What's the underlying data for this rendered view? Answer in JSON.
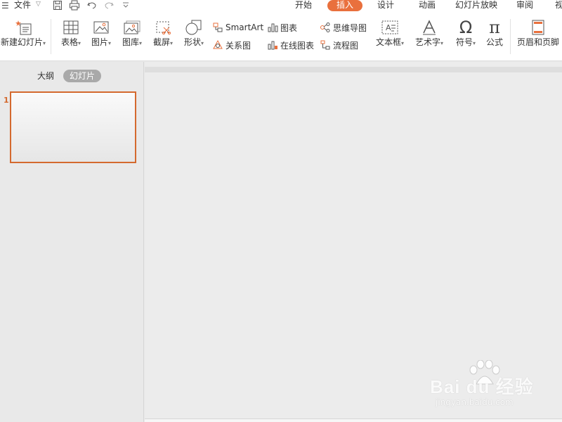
{
  "topbar": {
    "menu_glyph": "☰",
    "file_label": "文件",
    "file_arrow": "▽",
    "tabs": [
      "开始",
      "插入",
      "设计",
      "动画",
      "幻灯片放映",
      "审阅",
      "视"
    ]
  },
  "ribbon": {
    "new_slide": "新建幻灯片",
    "table": "表格",
    "picture": "图片",
    "gallery": "图库",
    "screenshot": "截屏",
    "shape": "形状",
    "smartart": "SmartArt",
    "relation": "关系图",
    "chart": "图表",
    "online_chart": "在线图表",
    "mindmap": "思维导图",
    "flowchart": "流程图",
    "textbox": "文本框",
    "wordart": "艺术字",
    "symbol": "符号",
    "formula": "公式",
    "header_footer": "页眉和页脚",
    "dropdown": "▾",
    "omega": "Ω",
    "pi": "π"
  },
  "leftpanel": {
    "outline_tab": "大纲",
    "slides_tab": "幻灯片",
    "slide_number": "1"
  },
  "watermark": {
    "brand": "Bai du 经验",
    "url": "jingyan.baidu.com"
  },
  "colors": {
    "accent": "#e9703d",
    "selection_border": "#d4692e"
  }
}
